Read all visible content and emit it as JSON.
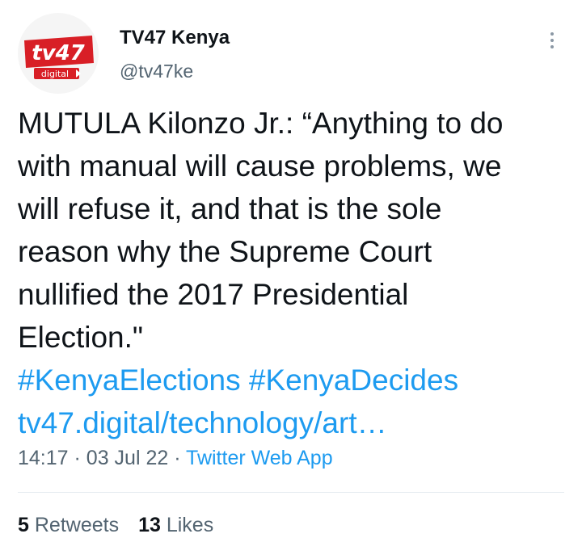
{
  "author": {
    "name": "TV47 Kenya",
    "handle": "@tv47ke",
    "avatar_icon": "tv47-digital-logo",
    "avatar_text_main": "tv47",
    "avatar_text_sub": "digital",
    "brand_color": "#d81f26"
  },
  "tweet": {
    "lines": [
      "MUTULA Kilonzo Jr.: “Anything to do",
      "with manual will cause problems, we",
      "will refuse it, and that is the sole",
      "reason why the Supreme Court",
      "nullified the 2017 Presidential",
      "Election.\""
    ],
    "hashtags": [
      "#KenyaElections",
      "#KenyaDecides"
    ],
    "link": "tv47.digital/technology/art…"
  },
  "meta": {
    "time": "14:17",
    "separator": "·",
    "date": "03 Jul 22",
    "app": "Twitter Web App"
  },
  "stats": {
    "retweets_count": "5",
    "retweets_label": "Retweets",
    "likes_count": "13",
    "likes_label": "Likes"
  },
  "colors": {
    "link": "#1d9bf0",
    "secondary_text": "#536471",
    "primary_text": "#0f1419"
  }
}
